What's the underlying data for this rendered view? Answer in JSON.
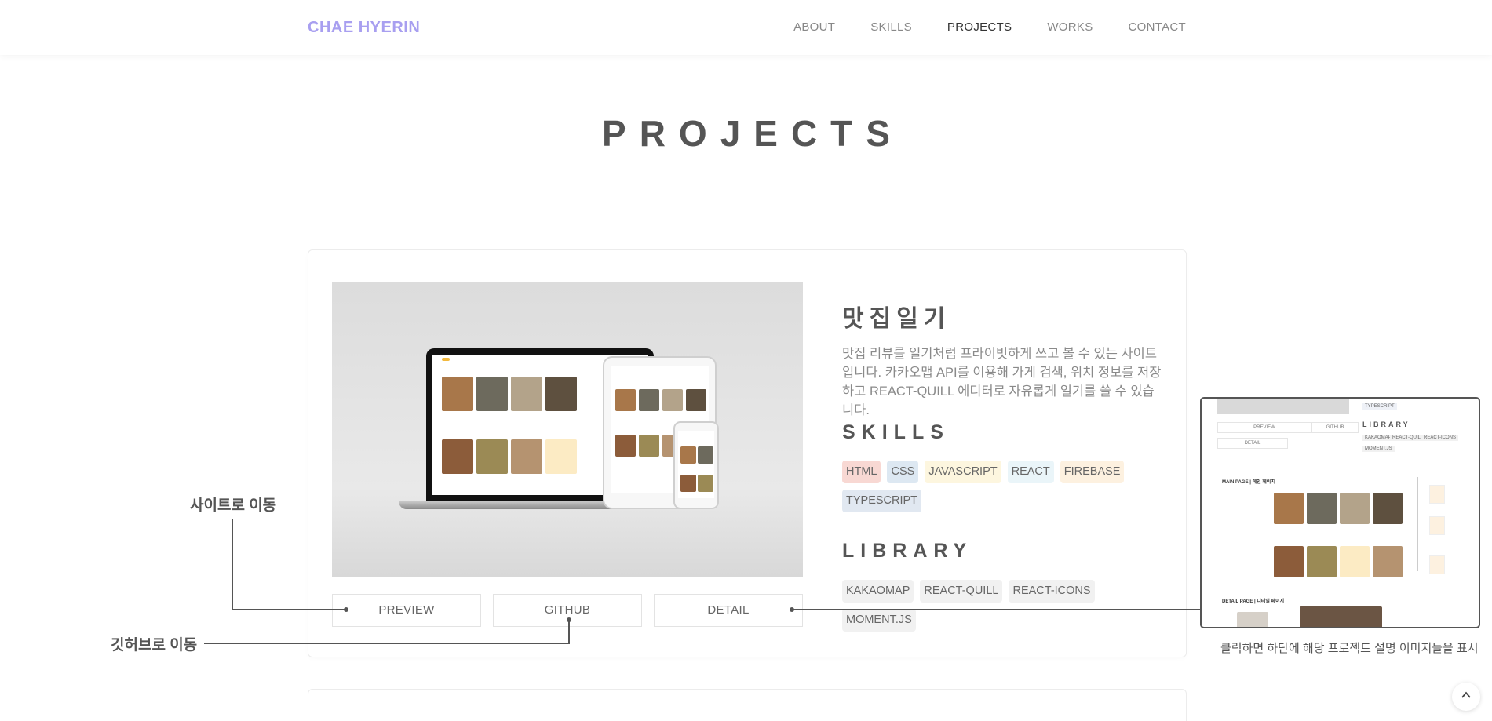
{
  "header": {
    "logo": "CHAE HYERIN",
    "nav": [
      "ABOUT",
      "SKILLS",
      "PROJECTS",
      "WORKS",
      "CONTACT"
    ],
    "active_nav": "PROJECTS"
  },
  "section_title": "PROJECTS",
  "project": {
    "title": "맛집일기",
    "description": "맛집 리뷰를 일기처럼 프라이빗하게 쓰고 볼 수 있는 사이트입니다. 카카오맵 API를 이용해 가게 검색, 위치 정보를 저장하고 REACT-QUILL 에디터로 자유롭게 일기를 쓸 수 있습니다.",
    "skills_heading": "SKILLS",
    "skills": [
      {
        "label": "HTML",
        "bg": "#f8d8d3"
      },
      {
        "label": "CSS",
        "bg": "#dde8f2"
      },
      {
        "label": "JAVASCRIPT",
        "bg": "#fdf6df"
      },
      {
        "label": "REACT",
        "bg": "#eaf5f9"
      },
      {
        "label": "FIREBASE",
        "bg": "#fdf1e0"
      },
      {
        "label": "TYPESCRIPT",
        "bg": "#e1e8f1"
      }
    ],
    "library_heading": "LIBRARY",
    "libraries": [
      "KAKAOMAP",
      "REACT-QUILL",
      "REACT-ICONS",
      "MOMENT.JS"
    ],
    "buttons": {
      "preview": "PREVIEW",
      "github": "GITHUB",
      "detail": "DETAIL"
    }
  },
  "annotations": {
    "site": "사이트로 이동",
    "github": "깃허브로 이동",
    "detail": "클릭하면 하단에 해당 프로젝트 설명 이미지들을 표시"
  },
  "preview_box": {
    "typescript_tag": "TYPESCRIPT",
    "library_heading": "LIBRARY",
    "libraries": [
      "KAKAOMAP",
      "REACT-QUILL",
      "REACT-ICONS",
      "MOMENT.JS"
    ],
    "buttons": [
      "PREVIEW",
      "GITHUB",
      "DETAIL"
    ],
    "main_page": "MAIN PAGE | 메인 페이지",
    "detail_page": "DETAIL PAGE | 디테일 페이지"
  },
  "scroll_top_icon": "chevron-up-icon"
}
